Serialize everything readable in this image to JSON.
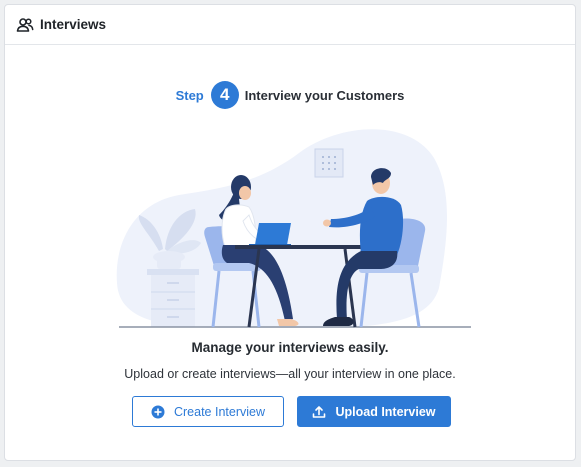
{
  "header": {
    "title": "Interviews",
    "icon": "users-icon"
  },
  "step": {
    "label": "Step",
    "number": "4",
    "title": "Interview your Customers"
  },
  "empty_state": {
    "headline": "Manage your interviews easily.",
    "description": "Upload or create interviews—all your interview in one place."
  },
  "actions": {
    "create_label": "Create Interview",
    "create_icon": "plus-circle-icon",
    "upload_label": "Upload Interview",
    "upload_icon": "upload-icon"
  },
  "colors": {
    "accent": "#2d7ad6",
    "illustration_bg": "#eef2fb"
  }
}
